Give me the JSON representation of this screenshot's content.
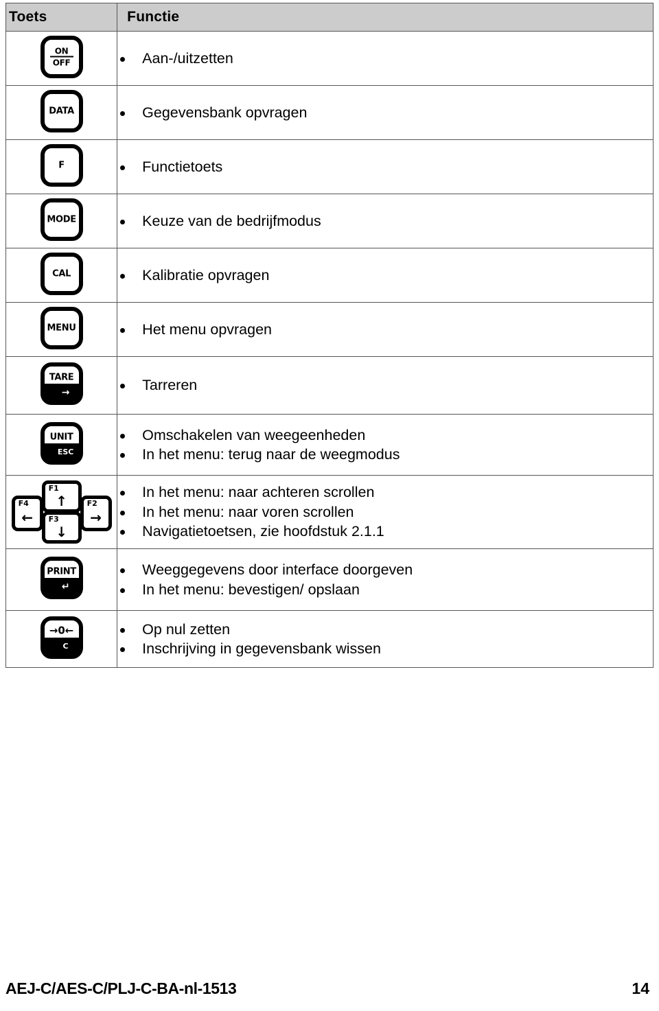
{
  "table": {
    "headers": {
      "key_column": "Toets",
      "function_column": "Functie"
    },
    "rows": [
      {
        "key_icon": "on-off-key-icon",
        "key_label_top": "ON",
        "key_label_bottom": "OFF",
        "functions": [
          "Aan-/uitzetten"
        ]
      },
      {
        "key_icon": "data-key-icon",
        "key_label": "DATA",
        "functions": [
          "Gegevensbank opvragen"
        ]
      },
      {
        "key_icon": "f-key-icon",
        "key_label": "F",
        "functions": [
          "Functietoets"
        ]
      },
      {
        "key_icon": "mode-key-icon",
        "key_label": "MODE",
        "functions": [
          "Keuze van de bedrijfmodus"
        ]
      },
      {
        "key_icon": "cal-key-icon",
        "key_label": "CAL",
        "functions": [
          "Kalibratie opvragen"
        ]
      },
      {
        "key_icon": "menu-key-icon",
        "key_label": "MENU",
        "functions": [
          "Het menu opvragen"
        ]
      },
      {
        "key_icon": "tare-key-icon",
        "key_label": "TARE",
        "key_badge": "→",
        "functions": [
          "Tarreren"
        ]
      },
      {
        "key_icon": "unit-key-icon",
        "key_label": "UNIT",
        "key_badge": "ESC",
        "functions": [
          "Omschakelen van weegeenheden",
          "In het menu: terug naar de weegmodus"
        ]
      },
      {
        "key_icon": "navigation-cluster-icon",
        "nav_keys": [
          {
            "name": "F1",
            "arrow": "↑",
            "icon": "arrow-up-icon"
          },
          {
            "name": "F2",
            "arrow": "→",
            "icon": "arrow-right-icon"
          },
          {
            "name": "F3",
            "arrow": "↓",
            "icon": "arrow-down-icon"
          },
          {
            "name": "F4",
            "arrow": "←",
            "icon": "arrow-left-icon"
          }
        ],
        "functions": [
          "In het menu: naar achteren scrollen",
          "In het menu: naar voren scrollen",
          "Navigatietoetsen, zie hoofdstuk 2.1.1"
        ]
      },
      {
        "key_icon": "print-key-icon",
        "key_label": "PRINT",
        "key_badge": "↵",
        "functions": [
          "Weeggegevens door interface doorgeven",
          "In het menu: bevestigen/ opslaan"
        ]
      },
      {
        "key_icon": "zero-key-icon",
        "key_label": "→0←",
        "key_badge": "C",
        "functions": [
          "Op nul zetten",
          "Inschrijving in gegevensbank wissen"
        ]
      }
    ]
  },
  "footer": {
    "document_id": "AEJ-C/AES-C/PLJ-C-BA-nl-1513",
    "page_number": "14"
  },
  "colors": {
    "header_background": "#cccccc",
    "border": "#555555",
    "text": "#000000",
    "key_outline": "#000000"
  }
}
